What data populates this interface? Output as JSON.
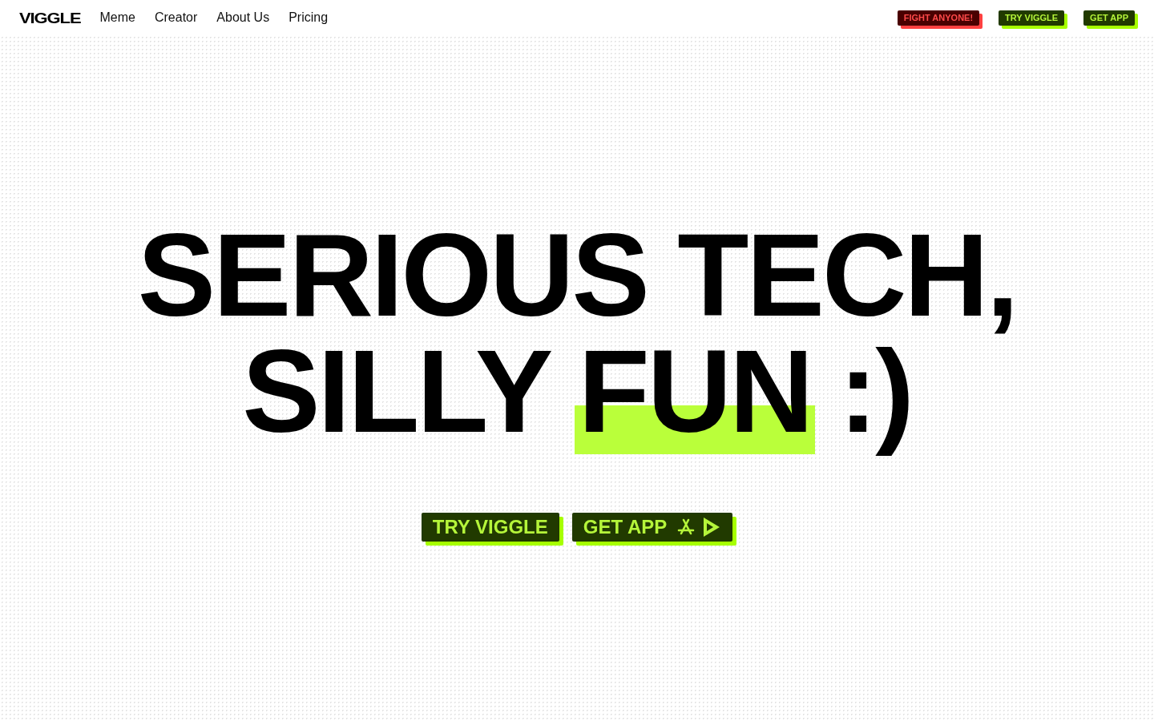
{
  "header": {
    "logo": "VIGGLE",
    "nav": [
      {
        "label": "Meme"
      },
      {
        "label": "Creator"
      },
      {
        "label": "About Us"
      },
      {
        "label": "Pricing"
      }
    ],
    "actions": [
      {
        "label": "FIGHT ANYONE!",
        "kind": "danger"
      },
      {
        "label": "TRY VIGGLE",
        "kind": "primary"
      },
      {
        "label": "GET APP",
        "kind": "primary"
      }
    ]
  },
  "hero": {
    "lines": [
      [
        {
          "text": "SERIOUS TECH,",
          "highlighted": false
        }
      ],
      [
        {
          "text": "SILLY",
          "highlighted": false
        },
        {
          "text": "FUN",
          "highlighted": true
        },
        {
          "text": ":)",
          "highlighted": false
        }
      ]
    ],
    "buttons": [
      {
        "label": "TRY VIGGLE",
        "kind": "plain"
      },
      {
        "label": "GET APP",
        "kind": "app"
      }
    ]
  }
}
